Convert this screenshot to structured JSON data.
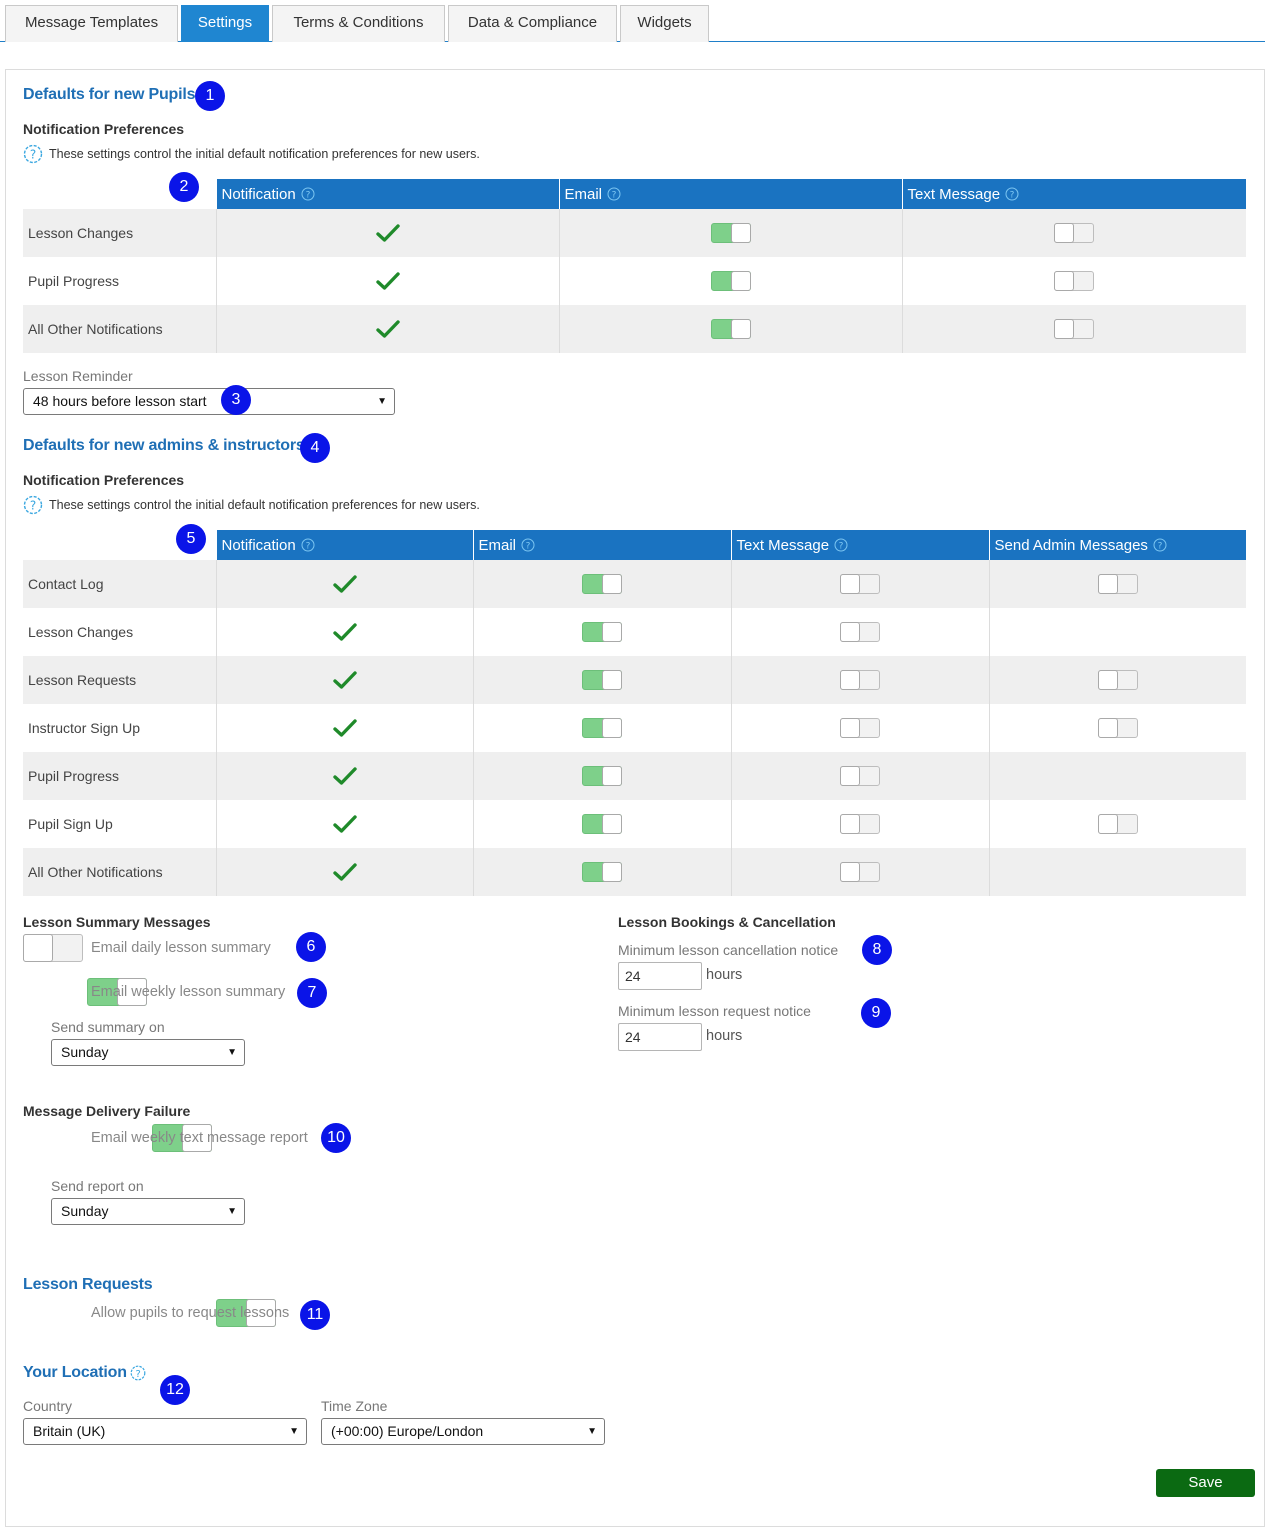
{
  "tabs": [
    {
      "label": "Message Templates"
    },
    {
      "label": "Settings"
    },
    {
      "label": "Terms & Conditions"
    },
    {
      "label": "Data & Compliance"
    },
    {
      "label": "Widgets"
    }
  ],
  "pupils": {
    "title": "Defaults for new Pupils",
    "notif_title": "Notification Preferences",
    "help": "These settings control the initial default notification preferences for new users.",
    "columns": [
      "Notification",
      "Email",
      "Text Message"
    ],
    "rows": [
      {
        "label": "Lesson Changes"
      },
      {
        "label": "Pupil Progress"
      },
      {
        "label": "All Other Notifications"
      }
    ],
    "reminder_label": "Lesson Reminder",
    "reminder_value": "48 hours before lesson start"
  },
  "admins": {
    "title": "Defaults for new admins & instructors",
    "notif_title": "Notification Preferences",
    "help": "These settings control the initial default notification preferences for new users.",
    "columns": [
      "Notification",
      "Email",
      "Text Message",
      "Send Admin Messages"
    ],
    "rows": [
      {
        "label": "Contact Log"
      },
      {
        "label": "Lesson Changes"
      },
      {
        "label": "Lesson Requests"
      },
      {
        "label": "Instructor Sign Up"
      },
      {
        "label": "Pupil Progress"
      },
      {
        "label": "Pupil Sign Up"
      },
      {
        "label": "All Other Notifications"
      }
    ]
  },
  "summary": {
    "title": "Lesson Summary Messages",
    "daily_label": "Email daily lesson summary",
    "weekly_label": "Email weekly lesson summary",
    "send_on_label": "Send summary on",
    "send_on_value": "Sunday"
  },
  "bookings": {
    "title": "Lesson Bookings & Cancellation",
    "cancel_label": "Minimum lesson cancellation notice",
    "cancel_value": "24",
    "cancel_unit": "hours",
    "request_label": "Minimum lesson request notice",
    "request_value": "24",
    "request_unit": "hours"
  },
  "delivery": {
    "title": "Message Delivery Failure",
    "report_label": "Email weekly text message report",
    "send_on_label": "Send report on",
    "send_on_value": "Sunday"
  },
  "requests": {
    "title": "Lesson Requests",
    "allow_label": "Allow pupils to request lessons"
  },
  "location": {
    "title": "Your Location",
    "country_label": "Country",
    "country_value": "Britain (UK)",
    "tz_label": "Time Zone",
    "tz_value": "(+00:00) Europe/London"
  },
  "save_label": "Save",
  "badges": [
    "1",
    "2",
    "3",
    "4",
    "5",
    "6",
    "7",
    "8",
    "9",
    "10",
    "11",
    "12"
  ],
  "colors": {
    "accent": "#1a73c1",
    "active_tab": "#1f86d1",
    "toggle_on": "#7ed08a",
    "check": "#1f8a2a",
    "save": "#0b6a12",
    "badge": "#0a14e8"
  }
}
